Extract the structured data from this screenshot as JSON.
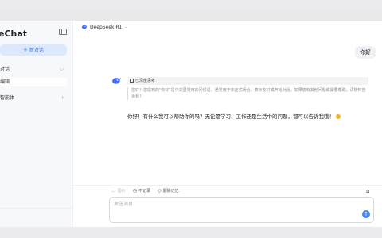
{
  "sidebar": {
    "app_name": "eChat",
    "new_chat_label": "新对话",
    "items": [
      {
        "label": "对话",
        "chevron": "⌵"
      },
      {
        "label": "编辑",
        "chevron": ""
      },
      {
        "label": "智能体",
        "chevron": "›"
      }
    ]
  },
  "header": {
    "model_name": "DeepSeek R1",
    "model_chevron": "⌄"
  },
  "chat": {
    "user_message": "你好",
    "thinking_title": "已深度思考",
    "thinking_text": "您好！您提到的\"你好\"是中文里常用的问候语，通常用于非正式场合，表示友好或开始对话。如果您有其他问题或需要帮助，请随时告诉我！",
    "answer": "你好！有什么我可以帮助你的吗？无论是学习、工作还是生活中的问题，都可以告诉我哦！"
  },
  "composer": {
    "tools": [
      {
        "label": "图片",
        "icon": "image-icon",
        "enabled": false
      },
      {
        "label": "不记录",
        "icon": "clock-icon",
        "enabled": true
      },
      {
        "label": "删除记忆",
        "icon": "eraser-icon",
        "enabled": true
      }
    ],
    "placeholder": "发送消息"
  },
  "colors": {
    "accent": "#4a86f0",
    "new_chat_bg": "#dbe8fd",
    "sidebar_bg": "#f6f8fb"
  }
}
